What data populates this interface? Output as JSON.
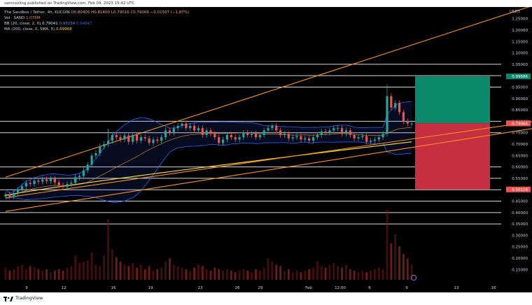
{
  "header": {
    "published": "samcooling published on TradingView.com, Feb 09, 2023 15:42 UTC"
  },
  "footer": {
    "brand": "TradingView"
  },
  "legend": {
    "title": "The Sandbox / Tether, 4h, KUCOIN",
    "ohlc": "O0.80405 H0.81400 L0.79016 C0.79066 −0.01507 (−1.87%)",
    "vol_label": "Vol · SAND",
    "vol_value": "1.078M",
    "bb_label": "BB (20, close, 2, 0)",
    "bb_values": [
      "0.79041",
      "0.93234",
      "0.64847"
    ],
    "ma_label": "MA (200, close, 0, SMA, 5)",
    "ma_value": "0.69968"
  },
  "currency": "USDT",
  "colors": {
    "up": "#26a69a",
    "down": "#ef5350",
    "bb": "#2962ff",
    "ma": "#f2d33a",
    "trend": "#f7931a",
    "profit_zone": "#0b8a6b",
    "loss_zone": "#c62f3f"
  },
  "chart_data": {
    "type": "candlestick",
    "timeframe": "4h",
    "x_ticks": [
      "9",
      "12",
      "16",
      "19",
      "23",
      "26",
      "29",
      "Feb",
      "12:00",
      "6",
      "9",
      "13",
      "16"
    ],
    "y_ticks": [
      1.25,
      1.2,
      1.15,
      1.1,
      1.05,
      1.0,
      0.95,
      0.9,
      0.85,
      0.8,
      0.75,
      0.7,
      0.65,
      0.6,
      0.55,
      0.5,
      0.45,
      0.4,
      0.35,
      0.3,
      0.25,
      0.2,
      0.15
    ],
    "ylim": [
      0.105,
      1.295
    ],
    "horizontal_levels": [
      1.05,
      1.0,
      0.95,
      0.8,
      0.75,
      0.6,
      0.55,
      0.5,
      0.45,
      0.4,
      0.35
    ],
    "price_tags": [
      {
        "value": "0.99686",
        "color": "#0b8a6b"
      },
      {
        "value": "0.79170",
        "color": "#4a4f5c"
      },
      {
        "value": "0.79066",
        "color": "#ef5350"
      },
      {
        "value": "0.50126",
        "color": "#ef5350"
      }
    ],
    "position": {
      "target": 0.99686,
      "entry": 0.7917,
      "stop": 0.50126
    },
    "trendlines": [
      {
        "from": [
          0,
          0.555
        ],
        "to": [
          129,
          1.31
        ]
      },
      {
        "from": [
          0,
          0.465
        ],
        "to": [
          129,
          0.8
        ]
      },
      {
        "from": [
          0,
          0.405
        ],
        "to": [
          129,
          0.77
        ]
      }
    ],
    "candles": {
      "count": 100,
      "close": [
        0.48,
        0.47,
        0.485,
        0.5,
        0.515,
        0.53,
        0.525,
        0.54,
        0.535,
        0.545,
        0.538,
        0.548,
        0.532,
        0.52,
        0.512,
        0.525,
        0.53,
        0.555,
        0.56,
        0.585,
        0.61,
        0.65,
        0.66,
        0.69,
        0.7,
        0.715,
        0.74,
        0.73,
        0.72,
        0.738,
        0.71,
        0.74,
        0.715,
        0.73,
        0.725,
        0.705,
        0.72,
        0.715,
        0.73,
        0.76,
        0.75,
        0.77,
        0.78,
        0.79,
        0.77,
        0.78,
        0.76,
        0.77,
        0.74,
        0.76,
        0.745,
        0.73,
        0.705,
        0.72,
        0.74,
        0.73,
        0.72,
        0.73,
        0.75,
        0.74,
        0.745,
        0.73,
        0.74,
        0.76,
        0.77,
        0.78,
        0.76,
        0.74,
        0.745,
        0.725,
        0.73,
        0.735,
        0.72,
        0.725,
        0.715,
        0.73,
        0.74,
        0.755,
        0.75,
        0.76,
        0.77,
        0.77,
        0.745,
        0.76,
        0.74,
        0.725,
        0.73,
        0.735,
        0.71,
        0.715,
        0.72,
        0.73,
        0.745,
        0.91,
        0.86,
        0.88,
        0.84,
        0.8,
        0.79,
        0.79
      ],
      "volume": [
        0.08,
        0.06,
        0.07,
        0.09,
        0.1,
        0.07,
        0.09,
        0.08,
        0.07,
        0.06,
        0.07,
        0.05,
        0.06,
        0.07,
        0.06,
        0.08,
        0.09,
        0.16,
        0.11,
        0.12,
        0.13,
        0.18,
        0.1,
        0.09,
        0.16,
        0.4,
        0.2,
        0.15,
        0.12,
        0.1,
        0.09,
        0.11,
        0.08,
        0.1,
        0.07,
        0.09,
        0.06,
        0.07,
        0.08,
        0.12,
        0.14,
        0.1,
        0.09,
        0.08,
        0.07,
        0.06,
        0.08,
        0.1,
        0.09,
        0.07,
        0.06,
        0.08,
        0.07,
        0.06,
        0.07,
        0.06,
        0.05,
        0.06,
        0.07,
        0.06,
        0.05,
        0.07,
        0.06,
        0.08,
        0.14,
        0.12,
        0.1,
        0.09,
        0.06,
        0.07,
        0.05,
        0.06,
        0.05,
        0.06,
        0.07,
        0.08,
        0.12,
        0.09,
        0.08,
        0.1,
        0.11,
        0.09,
        0.08,
        0.1,
        0.07,
        0.06,
        0.05,
        0.06,
        0.05,
        0.06,
        0.07,
        0.08,
        0.07,
        0.46,
        0.24,
        0.3,
        0.22,
        0.17,
        0.14,
        0.1
      ]
    },
    "volume_max": 0.46
  }
}
